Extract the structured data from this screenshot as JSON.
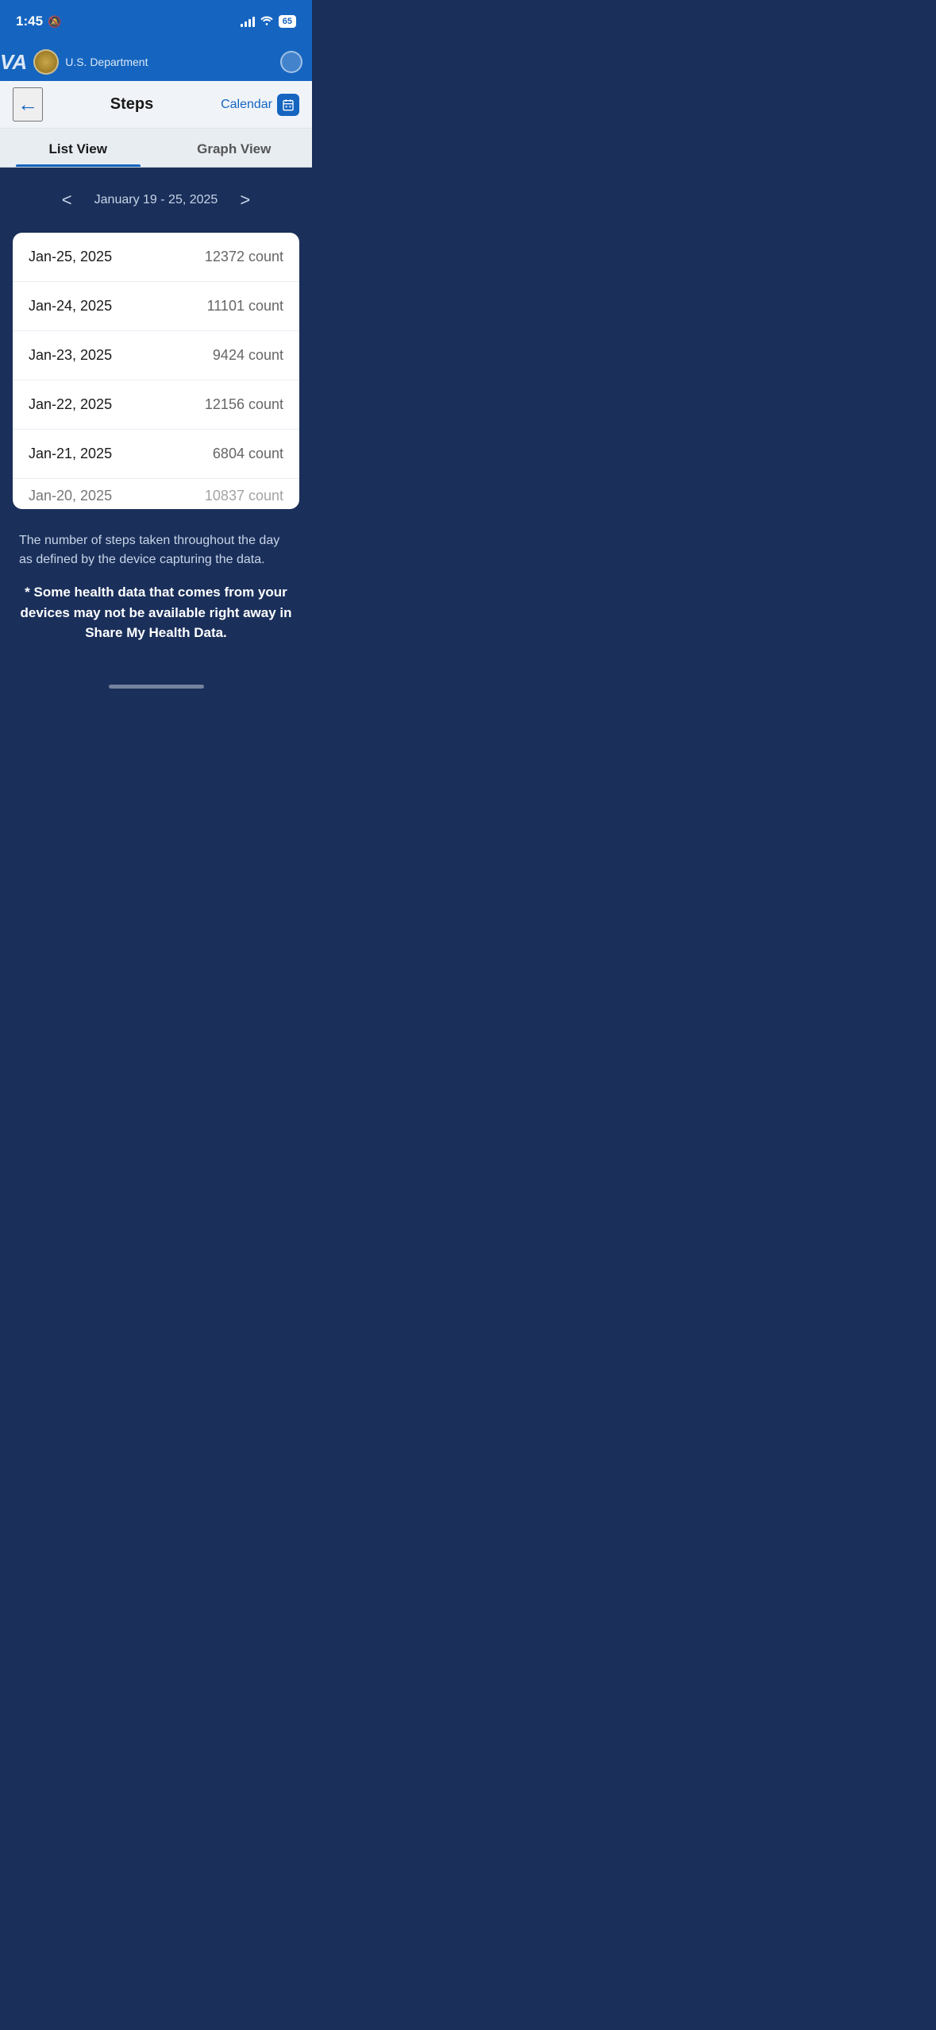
{
  "status_bar": {
    "time": "1:45",
    "battery": "65",
    "signal_bars": [
      4,
      7,
      10,
      13
    ],
    "mute_icon": "🔕"
  },
  "va_header": {
    "logo_text": "VA",
    "dept_text": "U.S. Department"
  },
  "nav": {
    "back_label": "←",
    "title": "Steps",
    "calendar_label": "Calendar",
    "calendar_icon": "📅"
  },
  "tabs": [
    {
      "label": "List View",
      "active": true
    },
    {
      "label": "Graph View",
      "active": false
    }
  ],
  "date_range": {
    "text": "January 19 - 25, 2025",
    "prev_arrow": "<",
    "next_arrow": ">"
  },
  "step_data": [
    {
      "date": "Jan-25, 2025",
      "count": "12372 count"
    },
    {
      "date": "Jan-24, 2025",
      "count": "11101 count"
    },
    {
      "date": "Jan-23, 2025",
      "count": "9424 count"
    },
    {
      "date": "Jan-22, 2025",
      "count": "12156 count"
    },
    {
      "date": "Jan-21, 2025",
      "count": "6804 count"
    },
    {
      "date": "Jan-20, 2025",
      "count": "10837 count"
    }
  ],
  "footer": {
    "description": "The number of steps taken throughout the day as defined by the device capturing the data.",
    "disclaimer": "* Some health data that comes from your devices may not be available right away in Share My Health Data."
  },
  "colors": {
    "primary_blue": "#1565c0",
    "dark_bg": "#1a2f5a",
    "light_bg": "#f0f4f8"
  }
}
